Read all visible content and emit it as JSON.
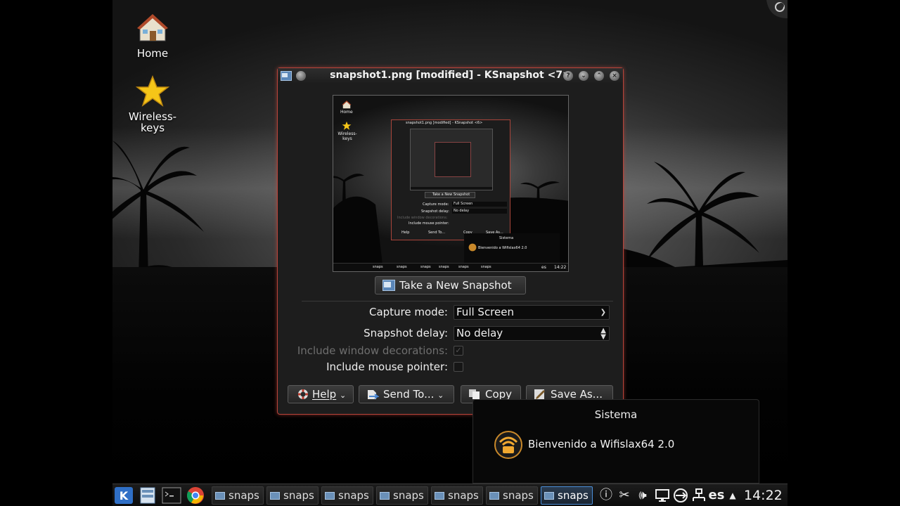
{
  "desktop": {
    "icons": [
      {
        "label": "Home",
        "icon": "home-folder-icon"
      },
      {
        "label": "Wireless-\nkeys",
        "icon": "star-icon"
      }
    ]
  },
  "window": {
    "title": "snapshot1.png [modified] - KSnapshot <7>",
    "take_snapshot_label": "Take a New Snapshot",
    "capture_mode_label": "Capture mode:",
    "capture_mode_value": "Full Screen",
    "snapshot_delay_label": "Snapshot delay:",
    "snapshot_delay_value": "No delay",
    "include_decorations_label": "Include window decorations:",
    "include_decorations_checked": true,
    "include_decorations_enabled": false,
    "include_pointer_label": "Include mouse pointer:",
    "include_pointer_checked": false,
    "buttons": {
      "help": "Help",
      "send_to": "Send To...",
      "copy": "Copy",
      "save_as": "Save As..."
    }
  },
  "preview": {
    "home": "Home",
    "wireless_keys": "Wireless-\nkeys",
    "window_title": "snapshot1.png [modified] - KSnapshot <6>",
    "take": "Take a New Snapshot",
    "capture_mode_label": "Capture mode:",
    "capture_mode_value": "Full Screen",
    "delay_label": "Snapshot delay:",
    "delay_value": "No delay",
    "deco_label": "Include window decorations:",
    "pointer_label": "Include mouse pointer:",
    "help": "Help",
    "send_to": "Send To...",
    "copy": "Copy",
    "save_as": "Save As...",
    "notif_title": "Sistema",
    "notif_body": "Bienvenido a Wifislax64 2.0",
    "task_label": "snaps",
    "lang": "es",
    "time": "14:22"
  },
  "notification": {
    "title": "Sistema",
    "body": "Bienvenido a Wifislax64 2.0"
  },
  "taskbar": {
    "tasks": [
      "snaps",
      "snaps",
      "snaps",
      "snaps",
      "snaps",
      "snaps",
      "snaps"
    ],
    "active_index": 6,
    "keyboard_layout": "es",
    "clock": "14:22"
  }
}
